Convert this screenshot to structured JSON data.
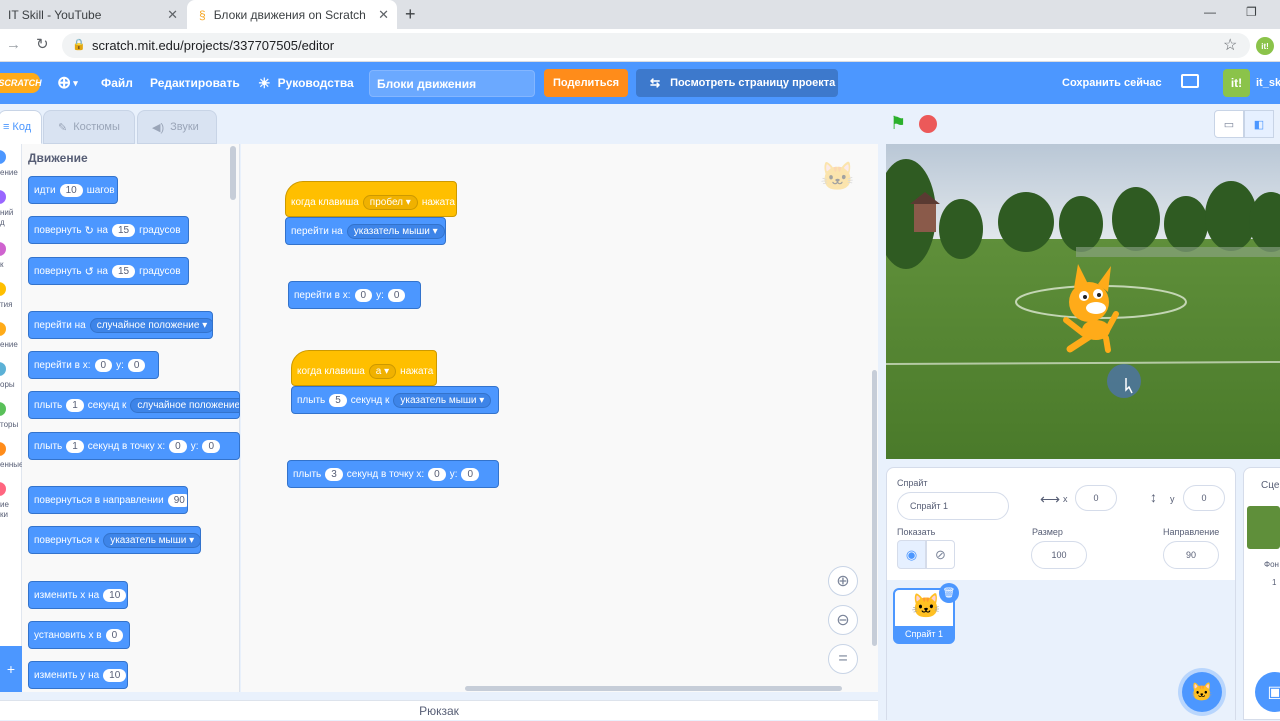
{
  "browser": {
    "tabs": [
      {
        "title": "IT Skill - YouTube"
      },
      {
        "title": "Блоки движения on Scratch"
      }
    ],
    "url": "scratch.mit.edu/projects/337707505/editor"
  },
  "menubar": {
    "logo": "SCRATCH",
    "file": "Файл",
    "edit": "Редактировать",
    "tutorials": "Руководства",
    "project_title": "Блоки движения",
    "share": "Поделиться",
    "see_project_page": "Посмотреть страницу проекта",
    "save_now": "Сохранить сейчас",
    "username": "it_ski",
    "user_badge": "it!"
  },
  "editor_tabs": {
    "code": "Код",
    "costumes": "Костюмы",
    "sounds": "Звуки"
  },
  "categories": {
    "motion": "ение",
    "looks": "ний\nд",
    "sound": "к",
    "events": "тия",
    "control": "ение",
    "sensing": "оры",
    "operators": "торы",
    "variables": "енные",
    "my_blocks": "ие\nки"
  },
  "palette": {
    "title": "Движение",
    "move": {
      "label": "идти",
      "value": "10",
      "suffix": "шагов"
    },
    "turn_right": {
      "label": "повернуть",
      "on": "на",
      "value": "15",
      "suffix": "градусов"
    },
    "turn_left": {
      "label": "повернуть",
      "on": "на",
      "value": "15",
      "suffix": "градусов"
    },
    "goto": {
      "label": "перейти на",
      "option": "случайное положение"
    },
    "goto_xy": {
      "label": "перейти в x:",
      "x": "0",
      "ylabel": "y:",
      "y": "0"
    },
    "glide_to": {
      "label": "плыть",
      "value": "1",
      "mid": "секунд к",
      "option": "случайное положение"
    },
    "glide_xy": {
      "label": "плыть",
      "value": "1",
      "mid": "секунд в точку x:",
      "x": "0",
      "ylabel": "y:",
      "y": "0"
    },
    "point_dir": {
      "label": "повернуться в направлении",
      "value": "90"
    },
    "point_towards": {
      "label": "повернуться к",
      "option": "указатель мыши"
    },
    "change_x": {
      "label": "изменить х на",
      "value": "10"
    },
    "set_x": {
      "label": "установить х в",
      "value": "0"
    },
    "change_y": {
      "label": "изменить у на",
      "value": "10"
    }
  },
  "scripts": {
    "s1_hat": {
      "label": "когда клавиша",
      "key": "пробел",
      "suffix": "нажата"
    },
    "s1_goto": {
      "label": "перейти на",
      "option": "указатель мыши"
    },
    "s2_goto_xy": {
      "label": "перейти в x:",
      "x": "0",
      "ylabel": "y:",
      "y": "0"
    },
    "s3_hat": {
      "label": "когда клавиша",
      "key": "a",
      "suffix": "нажата"
    },
    "s3_glide": {
      "label": "плыть",
      "value": "5",
      "mid": "секунд к",
      "option": "указатель мыши"
    },
    "s4_glide_xy": {
      "label": "плыть",
      "value": "3",
      "mid": "секунд в точку x:",
      "x": "0",
      "ylabel": "y:",
      "y": "0"
    }
  },
  "backpack": "Рюкзак",
  "sprite_info": {
    "sprite_label": "Спрайт",
    "sprite_name": "Спрайт 1",
    "x_label": "x",
    "x": "0",
    "y_label": "y",
    "y": "0",
    "show_label": "Показать",
    "size_label": "Размер",
    "size": "100",
    "direction_label": "Направление",
    "direction": "90",
    "thumb_name": "Спрайт 1"
  },
  "stage_panel": {
    "title": "Сцен",
    "backdrops_label": "Фон",
    "backdrops_count": "1"
  },
  "colors": {
    "motion": "#4c97ff",
    "events": "#ffbf00",
    "accent": "#4c97ff",
    "share": "#ff8c1a"
  }
}
